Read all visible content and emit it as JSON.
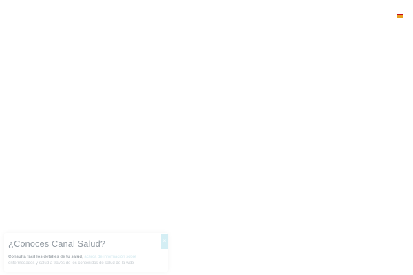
{
  "toast": {
    "title": "¿Conoces Canal Salud?",
    "text_strong": "Consulta fácil los detalles de tu salud",
    "text_link": "acerca de información sobre",
    "text_rest": "enfermedades y salud a través de los contenidos de salud de la web",
    "close_label": "×",
    "close_icon": "close-icon"
  },
  "header": {
    "language_flag_icon": "spain-flag-icon",
    "colors": {
      "flag_red": "#c60b1e",
      "flag_yellow": "#e8a020"
    }
  }
}
